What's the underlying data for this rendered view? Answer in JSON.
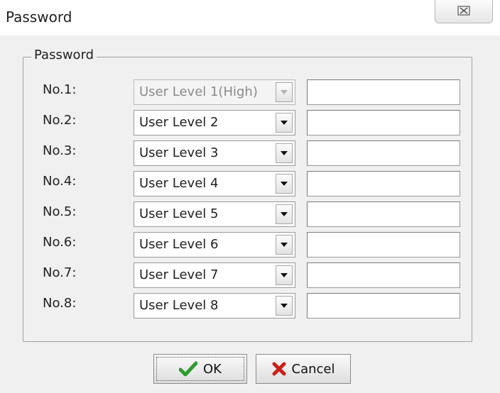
{
  "window": {
    "title": "Password",
    "close_glyph": "☒"
  },
  "group": {
    "label": "Password"
  },
  "rows": [
    {
      "label": "No.1:",
      "level": "User Level 1(High)",
      "password": "",
      "disabled": true
    },
    {
      "label": "No.2:",
      "level": "User Level 2",
      "password": ""
    },
    {
      "label": "No.3:",
      "level": "User Level 3",
      "password": ""
    },
    {
      "label": "No.4:",
      "level": "User Level 4",
      "password": ""
    },
    {
      "label": "No.5:",
      "level": "User Level 5",
      "password": ""
    },
    {
      "label": "No.6:",
      "level": "User Level 6",
      "password": ""
    },
    {
      "label": "No.7:",
      "level": "User Level 7",
      "password": ""
    },
    {
      "label": "No.8:",
      "level": "User Level 8",
      "password": ""
    }
  ],
  "buttons": {
    "ok": "OK",
    "cancel": "Cancel"
  },
  "icons": {
    "close": "close-icon",
    "ok": "checkmark-icon",
    "cancel": "x-mark-icon",
    "dropdown": "dropdown-arrow-icon"
  },
  "colors": {
    "ok_check": "#2e9a2e",
    "cancel_x": "#cc1f1a"
  }
}
